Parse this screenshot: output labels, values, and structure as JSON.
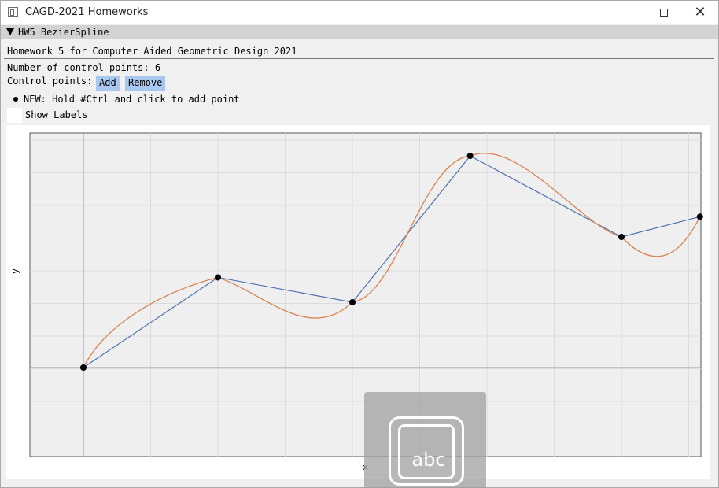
{
  "window": {
    "title": "CAGD-2021 Homeworks"
  },
  "section": {
    "title": "HW5 BezierSpline"
  },
  "description": "Homework 5 for Computer Aided Geometric Design 2021",
  "num_points_label": "Number of control points: 6",
  "control_points_label": "Control points:",
  "buttons": {
    "add": "Add",
    "remove": "Remove"
  },
  "hint": "NEW: Hold #Ctrl and click to add point",
  "show_labels": {
    "label": "Show Labels",
    "checked": false
  },
  "plot": {
    "xlabel": "x",
    "ylabel": "y",
    "control_points": [
      [
        -0.4,
        0
      ],
      [
        0.2,
        0.69
      ],
      [
        0.8,
        0.5
      ],
      [
        1.325,
        1.62
      ],
      [
        2.0,
        1.0
      ],
      [
        2.35,
        1.155
      ]
    ],
    "polygon_color": "#4c72b0",
    "curve_color": "#dd8452"
  },
  "ime": {
    "text": "abc"
  }
}
